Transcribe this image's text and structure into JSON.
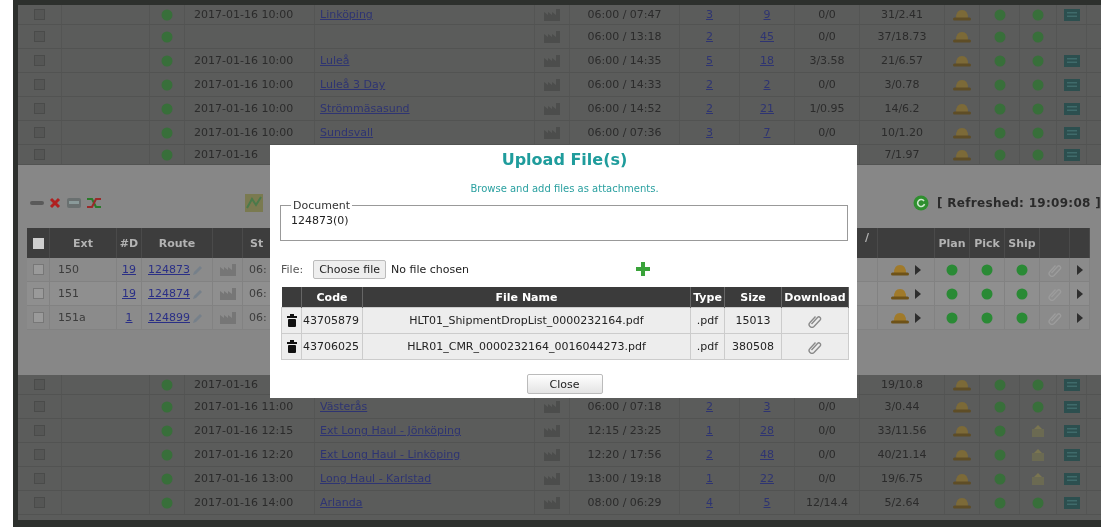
{
  "top_rows": [
    {
      "checked": false,
      "cells": [
        {
          "kind": "dot"
        },
        {
          "kind": "text",
          "text": "2017-01-16 10:00"
        },
        {
          "kind": "link",
          "text": "Linköping"
        },
        {
          "kind": "truck"
        },
        {
          "kind": "text",
          "text": "06:00 / 07:47"
        },
        {
          "kind": "link",
          "text": "3"
        },
        {
          "kind": "link",
          "text": "9"
        },
        {
          "kind": "text",
          "text": "0/0"
        },
        {
          "kind": "text",
          "text": "31/2.41"
        },
        {
          "kind": "hat"
        },
        {
          "kind": "dot"
        },
        {
          "kind": "dot"
        },
        {
          "kind": "doc"
        }
      ]
    },
    {
      "checked": false,
      "cells": [
        {
          "kind": "dot"
        },
        {
          "kind": "blank"
        },
        {
          "kind": "blank"
        },
        {
          "kind": "truck"
        },
        {
          "kind": "text",
          "text": "06:00 / 13:18"
        },
        {
          "kind": "link",
          "text": "2"
        },
        {
          "kind": "link",
          "text": "45"
        },
        {
          "kind": "text",
          "text": "0/0"
        },
        {
          "kind": "text",
          "text": "37/18.73"
        },
        {
          "kind": "hat"
        },
        {
          "kind": "dot"
        },
        {
          "kind": "dot"
        },
        {
          "kind": "blank"
        }
      ]
    },
    {
      "checked": false,
      "cells": [
        {
          "kind": "dot"
        },
        {
          "kind": "text",
          "text": "2017-01-16 10:00"
        },
        {
          "kind": "link",
          "text": "Luleå"
        },
        {
          "kind": "truck"
        },
        {
          "kind": "text",
          "text": "06:00 / 14:35"
        },
        {
          "kind": "link",
          "text": "5"
        },
        {
          "kind": "link",
          "text": "18"
        },
        {
          "kind": "text",
          "text": "3/3.58"
        },
        {
          "kind": "text",
          "text": "21/6.57"
        },
        {
          "kind": "hat"
        },
        {
          "kind": "dot"
        },
        {
          "kind": "dot"
        },
        {
          "kind": "doc"
        }
      ]
    },
    {
      "checked": false,
      "cells": [
        {
          "kind": "dot"
        },
        {
          "kind": "text",
          "text": "2017-01-16 10:00"
        },
        {
          "kind": "link",
          "text": "Luleå 3 Day"
        },
        {
          "kind": "truck"
        },
        {
          "kind": "text",
          "text": "06:00 / 14:33"
        },
        {
          "kind": "link",
          "text": "2"
        },
        {
          "kind": "link",
          "text": "2"
        },
        {
          "kind": "text",
          "text": "0/0"
        },
        {
          "kind": "text",
          "text": "3/0.78"
        },
        {
          "kind": "hat"
        },
        {
          "kind": "dot"
        },
        {
          "kind": "dot"
        },
        {
          "kind": "doc"
        }
      ]
    },
    {
      "checked": false,
      "cells": [
        {
          "kind": "dot"
        },
        {
          "kind": "text",
          "text": "2017-01-16 10:00"
        },
        {
          "kind": "link",
          "text": "Strömmäsasund"
        },
        {
          "kind": "truck"
        },
        {
          "kind": "text",
          "text": "06:00 / 14:52"
        },
        {
          "kind": "link",
          "text": "2"
        },
        {
          "kind": "link",
          "text": "21"
        },
        {
          "kind": "text",
          "text": "1/0.95"
        },
        {
          "kind": "text",
          "text": "14/6.2"
        },
        {
          "kind": "hat"
        },
        {
          "kind": "dot"
        },
        {
          "kind": "dot"
        },
        {
          "kind": "doc"
        }
      ]
    },
    {
      "checked": false,
      "cells": [
        {
          "kind": "dot"
        },
        {
          "kind": "text",
          "text": "2017-01-16 10:00"
        },
        {
          "kind": "link",
          "text": "Sundsvall"
        },
        {
          "kind": "truck"
        },
        {
          "kind": "text",
          "text": "06:00 / 07:36"
        },
        {
          "kind": "link",
          "text": "3"
        },
        {
          "kind": "link",
          "text": "7"
        },
        {
          "kind": "text",
          "text": "0/0"
        },
        {
          "kind": "text",
          "text": "10/1.20"
        },
        {
          "kind": "hat"
        },
        {
          "kind": "dot"
        },
        {
          "kind": "dot"
        },
        {
          "kind": "doc"
        }
      ]
    },
    {
      "checked": false,
      "cells": [
        {
          "kind": "dot"
        },
        {
          "kind": "text",
          "text": "2017-01-16"
        },
        {
          "kind": "blank"
        },
        {
          "kind": "blank"
        },
        {
          "kind": "blank"
        },
        {
          "kind": "blank"
        },
        {
          "kind": "blank"
        },
        {
          "kind": "blank"
        },
        {
          "kind": "text",
          "text": "7/1.97"
        },
        {
          "kind": "hat"
        },
        {
          "kind": "dot"
        },
        {
          "kind": "dot"
        },
        {
          "kind": "doc"
        }
      ]
    }
  ],
  "orders": {
    "header_checked": false,
    "columns": [
      "Ext",
      "#D",
      "Route",
      "St",
      "/",
      "Plan",
      "Pick",
      "Ship"
    ],
    "refreshed": "[ Refreshed: 19:09:08 ]",
    "rows": [
      {
        "checked": false,
        "ext": "150",
        "drops": "19",
        "route": "124873",
        "start": "06:"
      },
      {
        "checked": false,
        "ext": "151",
        "drops": "19",
        "route": "124874",
        "start": "06:"
      },
      {
        "checked": false,
        "ext": "151a",
        "drops": "1",
        "route": "124899",
        "start": "06:"
      }
    ]
  },
  "bottom_rows": [
    {
      "checked": false,
      "cells": [
        {
          "kind": "dot"
        },
        {
          "kind": "text",
          "text": "2017-01-16"
        },
        {
          "kind": "blank"
        },
        {
          "kind": "blank"
        },
        {
          "kind": "blank"
        },
        {
          "kind": "blank"
        },
        {
          "kind": "blank"
        },
        {
          "kind": "blank"
        },
        {
          "kind": "text",
          "text": "19/10.8"
        },
        {
          "kind": "hat"
        },
        {
          "kind": "dot"
        },
        {
          "kind": "dot"
        },
        {
          "kind": "doc"
        }
      ]
    },
    {
      "checked": false,
      "cells": [
        {
          "kind": "dot"
        },
        {
          "kind": "text",
          "text": "2017-01-16 11:00"
        },
        {
          "kind": "link",
          "text": "Västerås"
        },
        {
          "kind": "truck"
        },
        {
          "kind": "text",
          "text": "06:00 / 07:18"
        },
        {
          "kind": "link",
          "text": "2"
        },
        {
          "kind": "link",
          "text": "3"
        },
        {
          "kind": "text",
          "text": "0/0"
        },
        {
          "kind": "text",
          "text": "3/0.44"
        },
        {
          "kind": "hat"
        },
        {
          "kind": "dot"
        },
        {
          "kind": "dot"
        },
        {
          "kind": "doc"
        }
      ]
    },
    {
      "checked": false,
      "cells": [
        {
          "kind": "dot"
        },
        {
          "kind": "text",
          "text": "2017-01-16 12:15"
        },
        {
          "kind": "link",
          "text": "Ext Long Haul - Jönköping"
        },
        {
          "kind": "truck"
        },
        {
          "kind": "text",
          "text": "12:15 / 23:25"
        },
        {
          "kind": "link",
          "text": "1"
        },
        {
          "kind": "link",
          "text": "28"
        },
        {
          "kind": "text",
          "text": "0/0"
        },
        {
          "kind": "text",
          "text": "33/11.56"
        },
        {
          "kind": "hat"
        },
        {
          "kind": "dot"
        },
        {
          "kind": "pending"
        },
        {
          "kind": "doc"
        }
      ]
    },
    {
      "checked": false,
      "cells": [
        {
          "kind": "dot"
        },
        {
          "kind": "text",
          "text": "2017-01-16 12:20"
        },
        {
          "kind": "link",
          "text": "Ext Long Haul - Linköping"
        },
        {
          "kind": "truck"
        },
        {
          "kind": "text",
          "text": "12:20 / 17:56"
        },
        {
          "kind": "link",
          "text": "2"
        },
        {
          "kind": "link",
          "text": "48"
        },
        {
          "kind": "text",
          "text": "0/0"
        },
        {
          "kind": "text",
          "text": "40/21.14"
        },
        {
          "kind": "hat"
        },
        {
          "kind": "dot"
        },
        {
          "kind": "pending"
        },
        {
          "kind": "doc"
        }
      ]
    },
    {
      "checked": false,
      "cells": [
        {
          "kind": "dot"
        },
        {
          "kind": "text",
          "text": "2017-01-16 13:00"
        },
        {
          "kind": "link",
          "text": "Long Haul - Karlstad"
        },
        {
          "kind": "truck"
        },
        {
          "kind": "text",
          "text": "13:00 / 19:18"
        },
        {
          "kind": "link",
          "text": "1"
        },
        {
          "kind": "link",
          "text": "22"
        },
        {
          "kind": "text",
          "text": "0/0"
        },
        {
          "kind": "text",
          "text": "19/6.75"
        },
        {
          "kind": "hat"
        },
        {
          "kind": "dot"
        },
        {
          "kind": "pending"
        },
        {
          "kind": "doc"
        }
      ]
    },
    {
      "checked": false,
      "cells": [
        {
          "kind": "dot"
        },
        {
          "kind": "text",
          "text": "2017-01-16 14:00"
        },
        {
          "kind": "link",
          "text": "Arlanda"
        },
        {
          "kind": "truck"
        },
        {
          "kind": "text",
          "text": "08:00 / 06:29"
        },
        {
          "kind": "link",
          "text": "4"
        },
        {
          "kind": "link",
          "text": "5"
        },
        {
          "kind": "text",
          "text": "12/14.4"
        },
        {
          "kind": "text",
          "text": "5/2.64"
        },
        {
          "kind": "hat"
        },
        {
          "kind": "dot"
        },
        {
          "kind": "dot"
        },
        {
          "kind": "doc"
        }
      ]
    }
  ],
  "dialog": {
    "title": "Upload File(s)",
    "subtitle": "Browse and add files as attachments.",
    "document_legend": "Document",
    "document_value": "124873(0)",
    "file_label": "File:",
    "choose_button": "Choose file",
    "file_status": "No file chosen",
    "columns": [
      "Code",
      "File Name",
      "Type",
      "Size",
      "Download"
    ],
    "files": [
      {
        "code": "43705879",
        "name": "HLT01_ShipmentDropList_0000232164.pdf",
        "type": ".pdf",
        "size": "15013"
      },
      {
        "code": "43706025",
        "name": "HLR01_CMR_0000232164_0016044273.pdf",
        "type": ".pdf",
        "size": "380508"
      }
    ],
    "close_button": "Close"
  }
}
